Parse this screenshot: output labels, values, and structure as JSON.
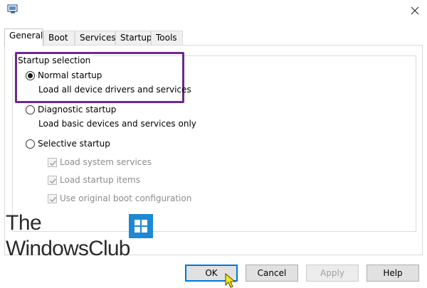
{
  "tabs": [
    {
      "label": "General"
    },
    {
      "label": "Boot"
    },
    {
      "label": "Services"
    },
    {
      "label": "Startup"
    },
    {
      "label": "Tools"
    }
  ],
  "startup_selection": {
    "title": "Startup selection",
    "normal": {
      "label": "Normal startup",
      "description": "Load all device drivers and services",
      "selected": true
    },
    "diagnostic": {
      "label": "Diagnostic startup",
      "description": "Load basic devices and services only",
      "selected": false
    },
    "selective": {
      "label": "Selective startup",
      "selected": false,
      "options": [
        {
          "label": "Load system services",
          "checked": true
        },
        {
          "label": "Load startup items",
          "checked": true
        },
        {
          "label": "Use original boot configuration",
          "checked": true
        }
      ]
    }
  },
  "buttons": {
    "ok": "OK",
    "cancel": "Cancel",
    "apply": "Apply",
    "help": "Help"
  },
  "watermark": {
    "line1": "The",
    "line2": "WindowsClub"
  },
  "colors": {
    "highlight": "#6b2a8c",
    "primary_border": "#0078d7",
    "logo": "#1e88d4",
    "cursor": "#f5e61a"
  },
  "icons": {
    "app": "msconfig-icon",
    "close": "close-icon",
    "watermark_logo": "windows-logo-icon",
    "pointer": "mouse-pointer-icon"
  }
}
